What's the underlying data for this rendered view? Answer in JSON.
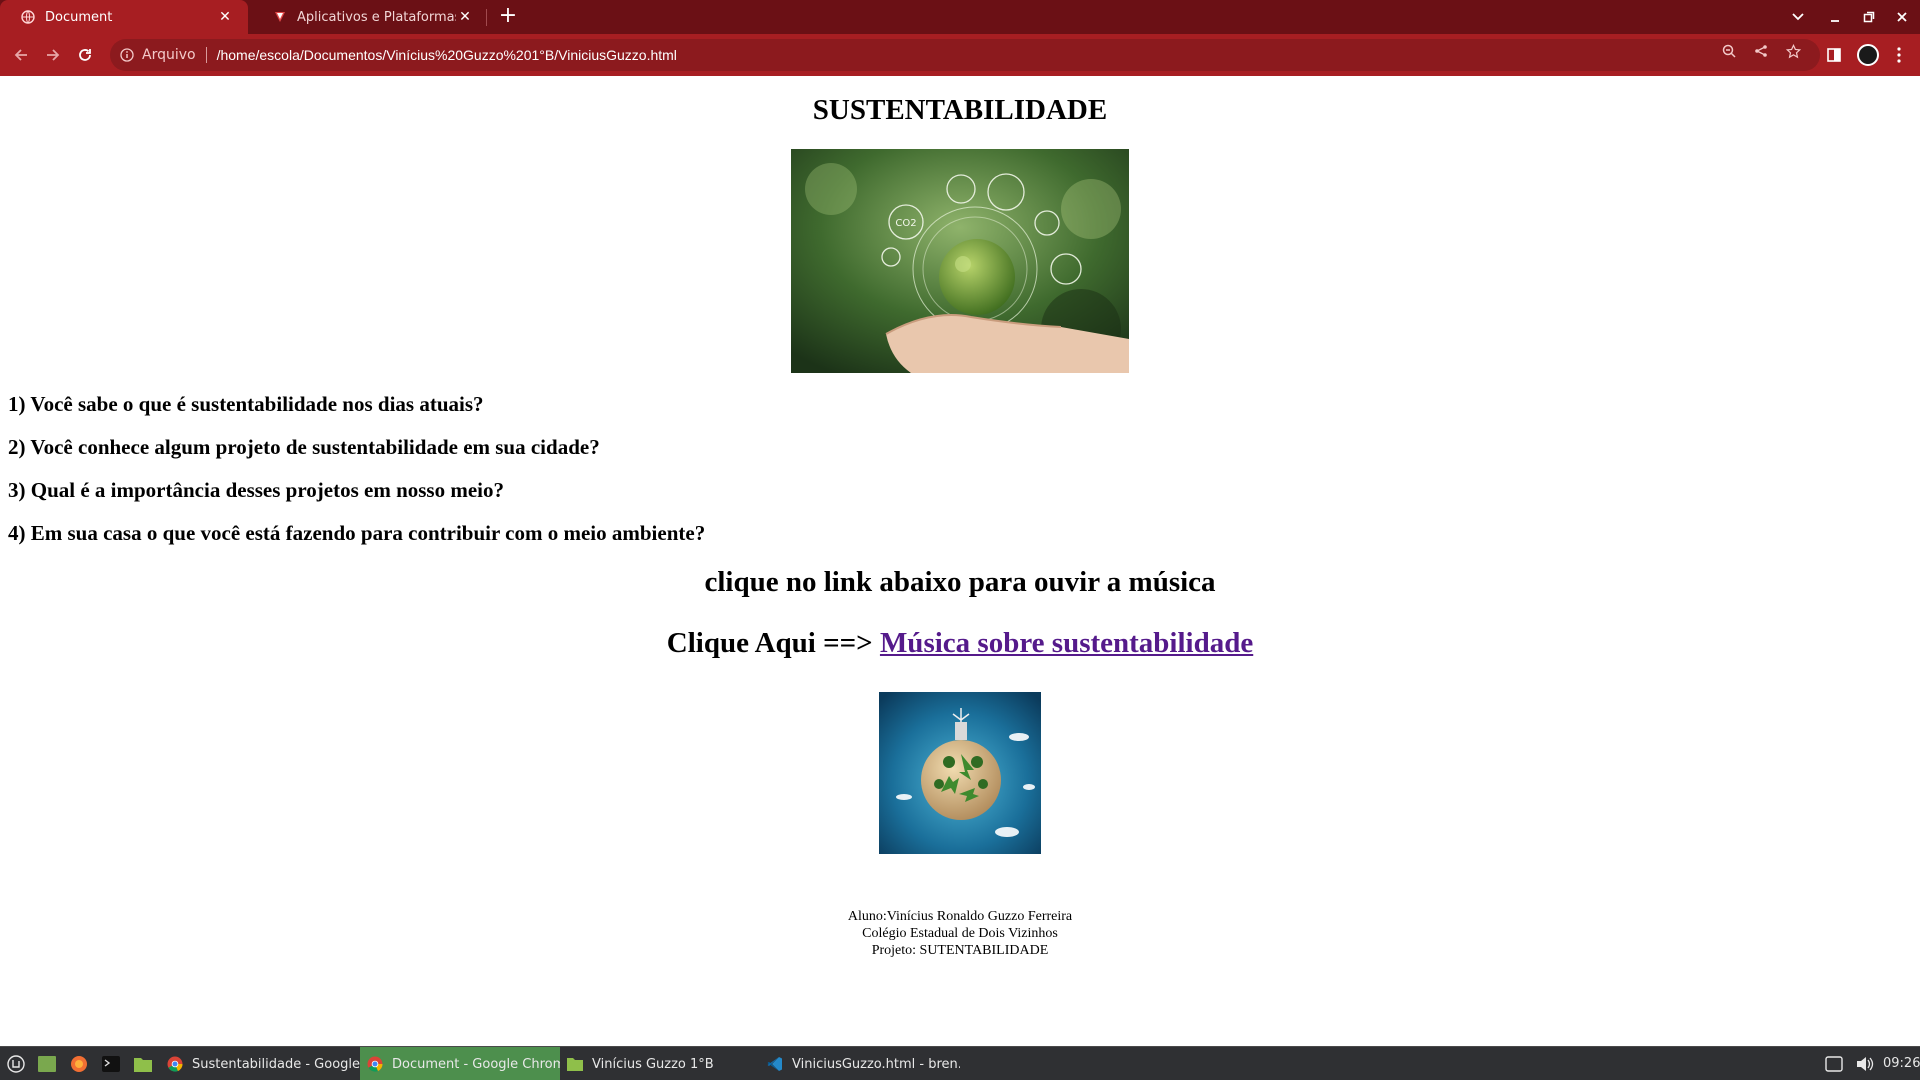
{
  "browser": {
    "tabs": [
      {
        "title": "Document",
        "active": true
      },
      {
        "title": "Aplicativos e Plataformas Edu",
        "active": false
      }
    ],
    "address": {
      "scheme_label": "Arquivo",
      "url": "/home/escola/Documentos/Vinícius%20Guzzo%201°B/ViniciusGuzzo.html"
    },
    "colors": {
      "frame": "#6b1015",
      "toolbar": "#a71e22",
      "omnibox": "#8c1a1e"
    }
  },
  "page": {
    "title": "SUSTENTABILIDADE",
    "questions": [
      "1) Você sabe o que é sustentabilidade nos dias atuais?",
      "2) Você conhece algum projeto de sustentabilidade em sua cidade?",
      "3) Qual é a importância desses projetos em nosso meio?",
      "4) Em sua casa o que você está fazendo para contribuir com o meio ambiente?"
    ],
    "music_heading": "clique no link abaixo para ouvir a música",
    "link_prefix": "Clique Aqui ==> ",
    "link_text": "Música sobre sustentabilidade",
    "credits": [
      "Aluno:Vinícius Ronaldo Guzzo Ferreira",
      "Colégio Estadual de Dois Vizinhos",
      "Projeto: SUTENTABILIDADE"
    ],
    "colors": {
      "link_visited": "#551a8b"
    }
  },
  "taskbar": {
    "apps": [
      {
        "label": "Sustentabilidade - Google ...",
        "icon": "chrome-icon",
        "active": false
      },
      {
        "label": "Document - Google Chrome",
        "icon": "chrome-icon",
        "active": true
      },
      {
        "label": "Vinícius Guzzo 1°B",
        "icon": "folder-icon",
        "active": false
      },
      {
        "label": "ViniciusGuzzo.html - bren...",
        "icon": "vscode-icon",
        "active": false
      }
    ],
    "clock": "09:26",
    "colors": {
      "active": "#4d8f4d",
      "background": "#2f3033"
    }
  }
}
